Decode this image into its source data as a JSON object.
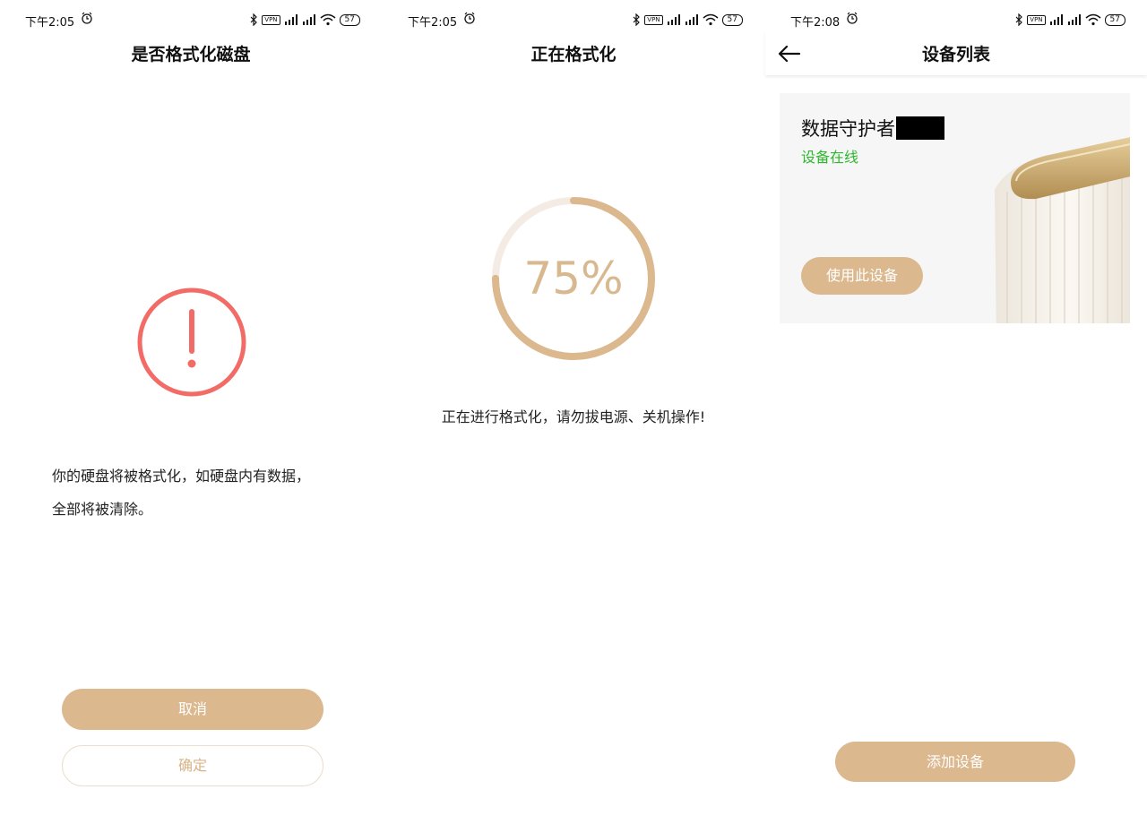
{
  "screen1": {
    "status_time": "下午2:05",
    "vpn": "VPN",
    "battery": "57",
    "title": "是否格式化磁盘",
    "warning_line1": "你的硬盘将被格式化，如硬盘内有数据，",
    "warning_line2": "全部将被清除。",
    "cancel_label": "取消",
    "confirm_label": "确定"
  },
  "screen2": {
    "status_time": "下午2:05",
    "vpn": "VPN",
    "battery": "57",
    "title": "正在格式化",
    "progress_text": "75%",
    "progress_fraction": 0.75,
    "note": "正在进行格式化，请勿拔电源、关机操作!"
  },
  "screen3": {
    "status_time": "下午2:08",
    "vpn": "VPN",
    "battery": "57",
    "title": "设备列表",
    "device_name": "数据守护者",
    "device_status": "设备在线",
    "use_device_label": "使用此设备",
    "add_device_label": "添加设备"
  },
  "colors": {
    "accent": "#dcb88e",
    "warning": "#f26b66",
    "online": "#2eb82e",
    "progress_track": "#f4ece4"
  },
  "icons": [
    "alarm-icon",
    "bluetooth-icon",
    "signal-icon",
    "wifi-icon",
    "battery-icon",
    "warning-icon",
    "back-arrow-icon"
  ]
}
